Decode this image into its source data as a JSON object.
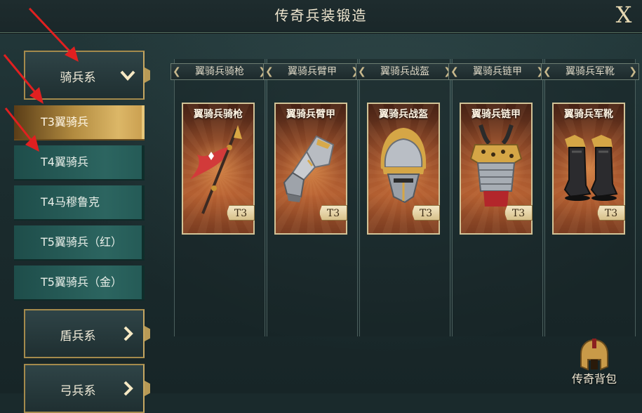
{
  "header": {
    "title": "传奇兵装锻造",
    "close_label": "X"
  },
  "sidebar": {
    "categories": [
      {
        "label": "骑兵系",
        "chevron": "down"
      },
      {
        "label": "盾兵系",
        "chevron": "right"
      },
      {
        "label": "弓兵系",
        "chevron": "right"
      }
    ],
    "units": [
      {
        "label": "T3翼骑兵",
        "active": true
      },
      {
        "label": "T4翼骑兵",
        "active": false
      },
      {
        "label": "T4马穆鲁克",
        "active": false
      },
      {
        "label": "T5翼骑兵（红）",
        "active": false
      },
      {
        "label": "T5翼骑兵（金）",
        "active": false
      }
    ]
  },
  "equipment": [
    {
      "slot_label": "翼骑兵骑枪",
      "card_name": "翼骑兵骑枪",
      "tier": "T3",
      "icon": "lance-icon"
    },
    {
      "slot_label": "翼骑兵臂甲",
      "card_name": "翼骑兵臂甲",
      "tier": "T3",
      "icon": "gauntlet-icon"
    },
    {
      "slot_label": "翼骑兵战盔",
      "card_name": "翼骑兵战盔",
      "tier": "T3",
      "icon": "helmet-icon"
    },
    {
      "slot_label": "翼骑兵链甲",
      "card_name": "翼骑兵链甲",
      "tier": "T3",
      "icon": "chainmail-icon"
    },
    {
      "slot_label": "翼骑兵军靴",
      "card_name": "翼骑兵军靴",
      "tier": "T3",
      "icon": "boots-icon"
    }
  ],
  "backpack": {
    "label": "传奇背包",
    "icon": "spartan-helmet-icon"
  },
  "colors": {
    "accent_gold": "#c7a862",
    "active_tab": "#dcb767",
    "arrow_red": "#e02020"
  }
}
